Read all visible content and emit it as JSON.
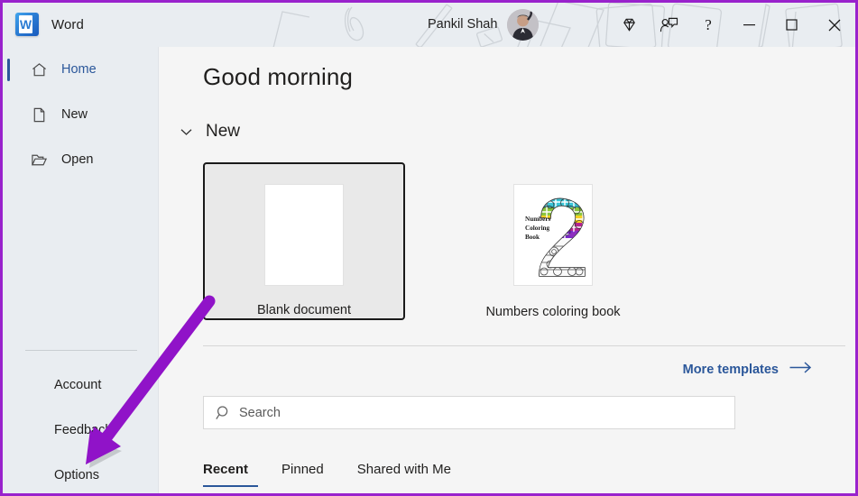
{
  "window": {
    "app_name": "Word",
    "app_icon": "word-logo-icon",
    "user_name": "Pankil Shah",
    "avatar": "user-avatar",
    "premium_icon": "diamond-icon",
    "account_manager_icon": "person-chat-icon",
    "help_icon": "question-mark-icon",
    "help_glyph": "?",
    "minimize_icon": "minimize-icon",
    "maximize_icon": "maximize-icon",
    "close_icon": "close-icon"
  },
  "sidebar": {
    "items": [
      {
        "label": "Home",
        "icon": "home-icon",
        "selected": true
      },
      {
        "label": "New",
        "icon": "new-document-icon",
        "selected": false
      },
      {
        "label": "Open",
        "icon": "open-folder-icon",
        "selected": false
      }
    ],
    "bottom_items": [
      {
        "label": "Account"
      },
      {
        "label": "Feedback"
      },
      {
        "label": "Options"
      }
    ]
  },
  "main": {
    "greeting": "Good morning",
    "new_section": {
      "title": "New",
      "collapse_icon": "chevron-down-icon",
      "templates": [
        {
          "label": "Blank document",
          "thumbnail": "blank-page-thumbnail",
          "focused": true
        },
        {
          "label": "Numbers coloring book",
          "thumbnail": "coloring-book-thumbnail",
          "focused": false
        }
      ],
      "more_templates_label": "More templates",
      "more_templates_icon": "arrow-right-icon"
    },
    "search": {
      "placeholder": "Search",
      "value": "",
      "icon": "search-icon"
    },
    "tabs": [
      {
        "label": "Recent",
        "active": true
      },
      {
        "label": "Pinned",
        "active": false
      },
      {
        "label": "Shared with Me",
        "active": false
      }
    ]
  },
  "thumbnail_text": {
    "coloring_book_line1": "Numbers",
    "coloring_book_line2": "Coloring",
    "coloring_book_line3": "Book",
    "coloring_book_numeral": "2"
  },
  "annotation": {
    "arrow_color": "#9013c8",
    "border_color": "#9922cc",
    "points_to": "Options"
  },
  "colors": {
    "accent": "#2b579a",
    "titlebar_bg": "#e9edf1",
    "main_bg": "#f5f5f5",
    "sidebar_bg": "#e9edf1",
    "card_focus_border": "#1a1a1a"
  }
}
